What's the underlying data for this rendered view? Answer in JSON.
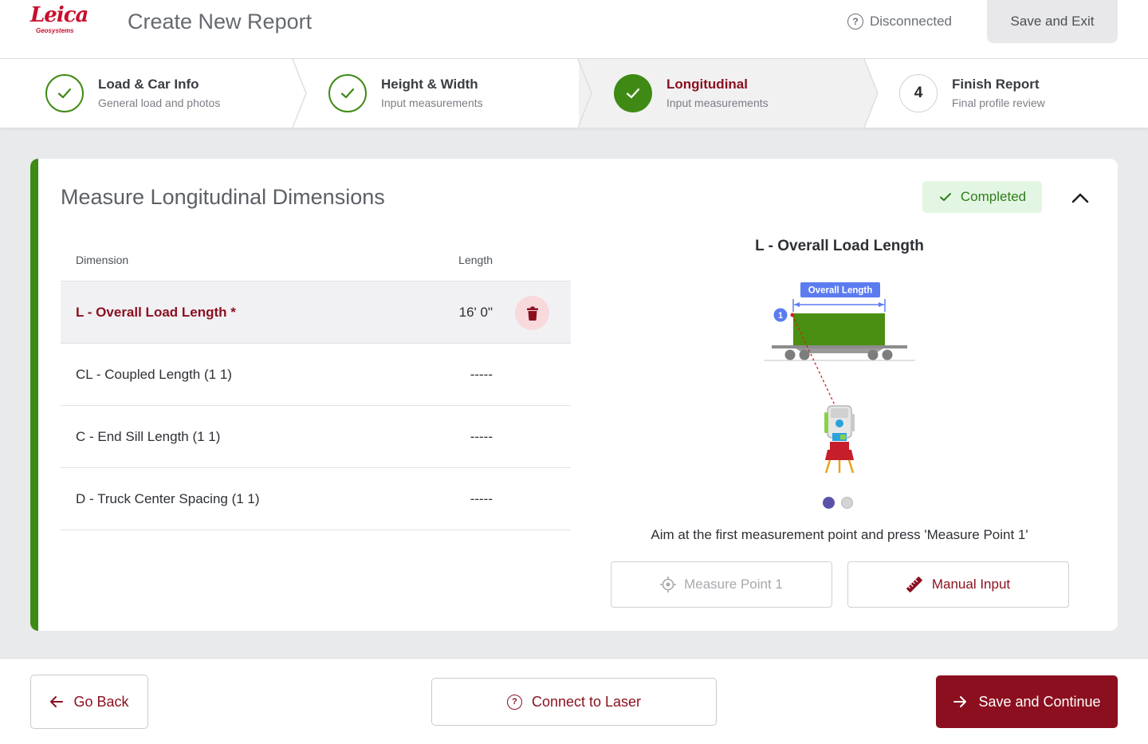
{
  "brand": {
    "logo_text": "Leica",
    "logo_sub": "Geosystems",
    "color": "#c8102e"
  },
  "header": {
    "title": "Create New Report",
    "connection_status": "Disconnected",
    "connection_icon": "question-circle-icon",
    "save_exit_label": "Save and Exit"
  },
  "stepper": {
    "steps": [
      {
        "title": "Load & Car Info",
        "subtitle": "General load and photos",
        "state": "done"
      },
      {
        "title": "Height & Width",
        "subtitle": "Input measurements",
        "state": "done"
      },
      {
        "title": "Longitudinal",
        "subtitle": "Input measurements",
        "state": "current"
      },
      {
        "number": "4",
        "title": "Finish Report",
        "subtitle": "Final profile review",
        "state": "todo"
      }
    ]
  },
  "section": {
    "title": "Measure Longitudinal Dimensions",
    "status_badge": "Completed",
    "table": {
      "columns": [
        "Dimension",
        "Length"
      ],
      "rows": [
        {
          "dimension": "L - Overall Load Length *",
          "length": "16' 0\"",
          "selected": true
        },
        {
          "dimension": "CL - Coupled Length (1 1)",
          "length": "-----",
          "selected": false
        },
        {
          "dimension": "C - End Sill Length (1 1)",
          "length": "-----",
          "selected": false
        },
        {
          "dimension": "D - Truck Center Spacing (1 1)",
          "length": "-----",
          "selected": false
        }
      ]
    },
    "diagram": {
      "title": "L - Overall Load Length",
      "dimension_label": "Overall Length",
      "point_marker": "1",
      "carousel_active": 1,
      "carousel_total": 2
    },
    "instruction": "Aim at the first measurement point and press 'Measure Point 1'",
    "measure_button": "Measure Point 1",
    "manual_button": "Manual Input"
  },
  "footer": {
    "back_label": "Go Back",
    "laser_label": "Connect to Laser",
    "continue_label": "Save and Continue"
  },
  "colors": {
    "accent_green": "#3f8a15",
    "primary_red": "#8b0f1e",
    "badge_bg": "#e3f6e3",
    "diagram_blue": "#5b7cf0"
  }
}
